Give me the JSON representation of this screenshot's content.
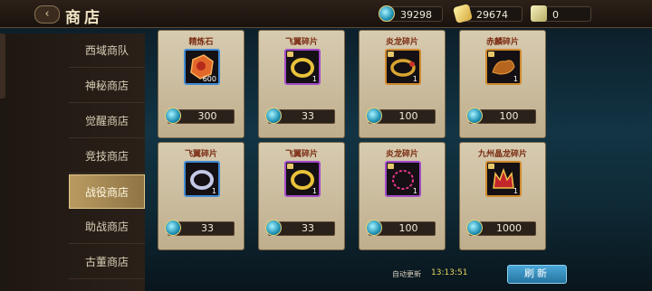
{
  "header": {
    "back_icon": "back-arrow-icon",
    "title": "商店",
    "resources": [
      {
        "icon": "gem-icon",
        "value": "39298"
      },
      {
        "icon": "gold-icon",
        "value": "29674"
      },
      {
        "icon": "scroll-icon",
        "value": "0"
      }
    ]
  },
  "sidebar": {
    "items": [
      {
        "label": "西域商队",
        "active": false
      },
      {
        "label": "神秘商店",
        "active": false
      },
      {
        "label": "觉醒商店",
        "active": false
      },
      {
        "label": "竞技商店",
        "active": false
      },
      {
        "label": "战役商店",
        "active": true
      },
      {
        "label": "助战商店",
        "active": false
      },
      {
        "label": "古董商店",
        "active": false
      }
    ]
  },
  "shop": {
    "items": [
      {
        "name": "精炼石",
        "qty": "600",
        "price": "300",
        "icon": "refine-stone-icon",
        "rarity_color": "#3f8ad3"
      },
      {
        "name": "飞翼碎片",
        "qty": "1",
        "price": "33",
        "icon": "gold-ring-icon",
        "rarity_color": "#a24bc8"
      },
      {
        "name": "炎龙碎片",
        "qty": "1",
        "price": "100",
        "icon": "gold-bracelet-icon",
        "rarity_color": "#d0892e"
      },
      {
        "name": "赤麟碎片",
        "qty": "1",
        "price": "100",
        "icon": "beast-fragment-icon",
        "rarity_color": "#d0892e"
      },
      {
        "name": "飞翼碎片",
        "qty": "1",
        "price": "33",
        "icon": "silver-ring-icon",
        "rarity_color": "#3f8ad3"
      },
      {
        "name": "飞翼碎片",
        "qty": "1",
        "price": "33",
        "icon": "gold-ring-icon",
        "rarity_color": "#a24bc8"
      },
      {
        "name": "炎龙碎片",
        "qty": "1",
        "price": "100",
        "icon": "pink-bracelet-icon",
        "rarity_color": "#a24bc8"
      },
      {
        "name": "九州晶龙碎片",
        "qty": "1",
        "price": "1000",
        "icon": "crown-fragment-icon",
        "rarity_color": "#d0892e"
      }
    ]
  },
  "footer": {
    "auto_refresh_label": "自动更新",
    "auto_refresh_time": "13:13:51",
    "refresh_button": "刷新"
  }
}
